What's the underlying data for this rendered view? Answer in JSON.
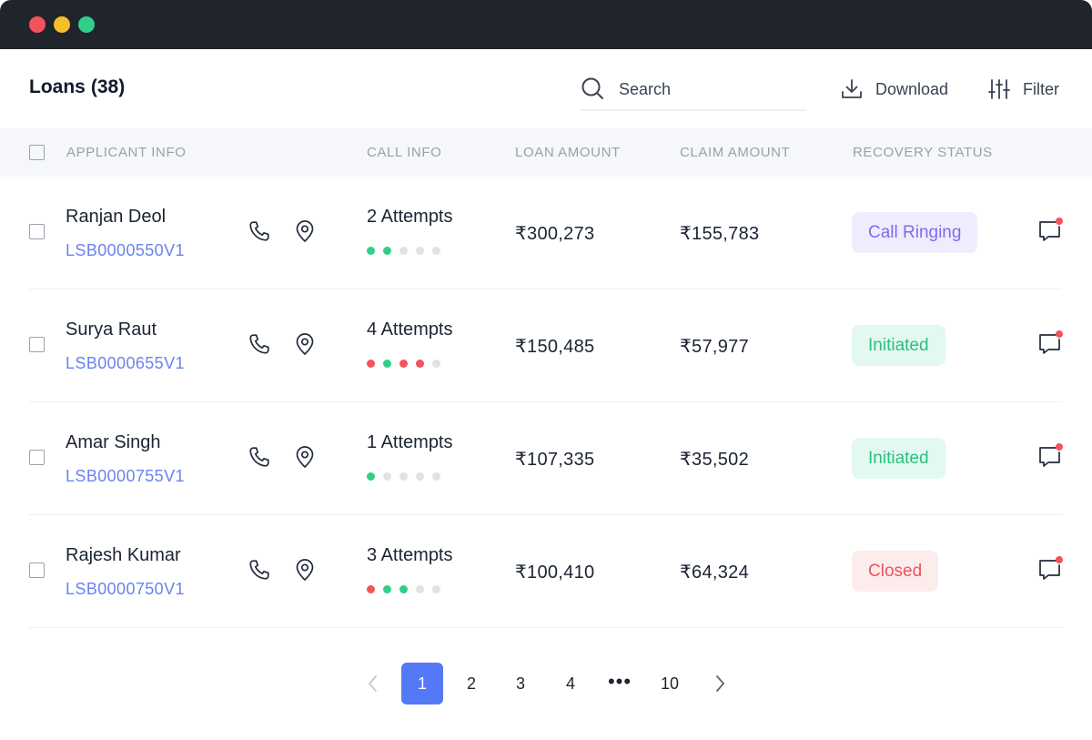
{
  "window": {
    "controls": [
      "close",
      "minimize",
      "maximize"
    ]
  },
  "header": {
    "title": "Loans",
    "count": "(38)",
    "search": {
      "placeholder": "Search",
      "value": ""
    },
    "download_label": "Download",
    "filter_label": "Filter"
  },
  "table": {
    "columns": {
      "applicant": "APPLICANT INFO",
      "call": "CALL INFO",
      "loan": "LOAN AMOUNT",
      "claim": "CLAIM AMOUNT",
      "recovery": "RECOVERY STATUS"
    },
    "rows": [
      {
        "name": "Ranjan Deol",
        "id": "LSB0000550V1",
        "attempts": "2 Attempts",
        "dots": [
          "green",
          "green",
          "gray",
          "gray",
          "gray"
        ],
        "loan": "₹300,273",
        "claim": "₹155,783",
        "status": "Call Ringing",
        "status_kind": "ringing"
      },
      {
        "name": "Surya Raut",
        "id": "LSB0000655V1",
        "attempts": "4 Attempts",
        "dots": [
          "red",
          "green",
          "red",
          "red",
          "gray"
        ],
        "loan": "₹150,485",
        "claim": "₹57,977",
        "status": "Initiated",
        "status_kind": "initiated"
      },
      {
        "name": "Amar Singh",
        "id": "LSB0000755V1",
        "attempts": "1 Attempts",
        "dots": [
          "green",
          "gray",
          "gray",
          "gray",
          "gray"
        ],
        "loan": "₹107,335",
        "claim": "₹35,502",
        "status": "Initiated",
        "status_kind": "initiated"
      },
      {
        "name": "Rajesh Kumar",
        "id": "LSB0000750V1",
        "attempts": "3 Attempts",
        "dots": [
          "red",
          "green",
          "green",
          "gray",
          "gray"
        ],
        "loan": "₹100,410",
        "claim": "₹64,324",
        "status": "Closed",
        "status_kind": "closed"
      }
    ]
  },
  "pagination": {
    "pages": [
      "1",
      "2",
      "3",
      "4"
    ],
    "ellipsis": "•••",
    "last": "10",
    "current": "1"
  },
  "colors": {
    "titlebar": "#20242c",
    "accent": "#5479f7",
    "link": "#6a82f0",
    "dot_green": "#2ecf8a",
    "dot_red": "#f2545b",
    "dot_gray": "#dfe2e7",
    "status_ringing_bg": "#efedfd",
    "status_ringing_fg": "#7b6cf0",
    "status_initiated_bg": "#e3f8ef",
    "status_initiated_fg": "#29c07d",
    "status_closed_bg": "#fdecec",
    "status_closed_fg": "#f0525a",
    "notification_dot": "#f2545b"
  },
  "icons": [
    "search-icon",
    "download-icon",
    "filter-icon",
    "phone-icon",
    "location-pin-icon",
    "chat-icon",
    "chevron-left-icon",
    "chevron-right-icon"
  ]
}
